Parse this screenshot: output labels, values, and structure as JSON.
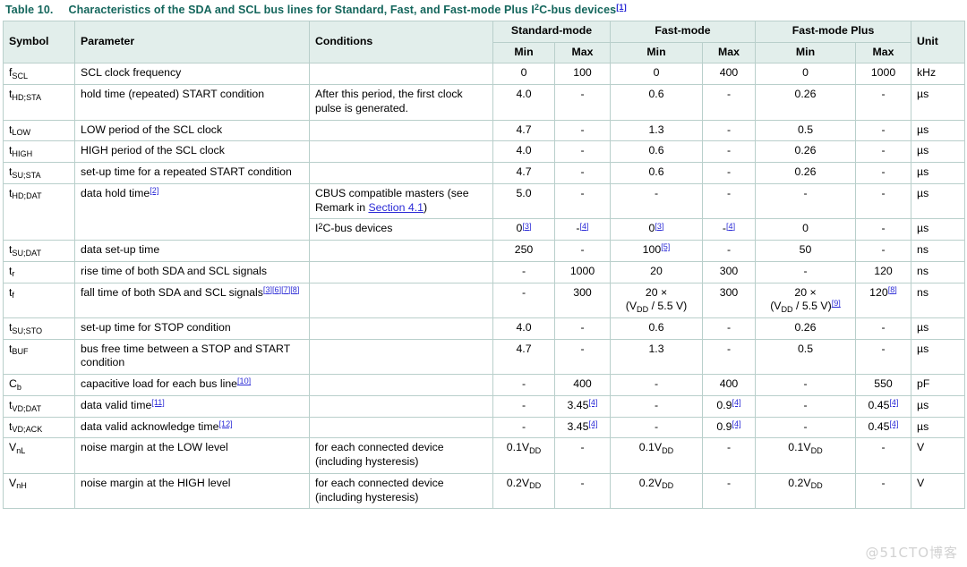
{
  "caption": {
    "number": "Table 10.",
    "text_before": "Characteristics of the SDA and SCL bus lines for Standard, Fast, and Fast-mode Plus I",
    "sup": "2",
    "text_after": "C-bus devices",
    "footnote": "[1]"
  },
  "header": {
    "symbol": "Symbol",
    "parameter": "Parameter",
    "conditions": "Conditions",
    "standard_mode": "Standard-mode",
    "fast_mode": "Fast-mode",
    "fast_mode_plus": "Fast-mode Plus",
    "unit": "Unit",
    "min": "Min",
    "max": "Max"
  },
  "watermark": "@51CTO博客",
  "colors": {
    "caption_text": "#14665c",
    "header_bg": "#e2eeeb",
    "border": "#b9cfcb",
    "link": "#2b2bd6",
    "watermark": "#d2d2d2"
  },
  "rows": [
    {
      "symbol_base": "f",
      "symbol_sub": "SCL",
      "parameter": "SCL clock frequency",
      "conditions": "",
      "sm_min": "0",
      "sm_max": "100",
      "fm_min": "0",
      "fm_max": "400",
      "fmp_min": "0",
      "fmp_max": "1000",
      "unit": "kHz"
    },
    {
      "symbol_base": "t",
      "symbol_sub": "HD;STA",
      "parameter": "hold time (repeated) START condition",
      "conditions": "After this period, the first clock pulse is generated.",
      "sm_min": "4.0",
      "sm_max": "-",
      "fm_min": "0.6",
      "fm_max": "-",
      "fmp_min": "0.26",
      "fmp_max": "-",
      "unit": "µs"
    },
    {
      "symbol_base": "t",
      "symbol_sub": "LOW",
      "parameter": "LOW period of the SCL clock",
      "conditions": "",
      "sm_min": "4.7",
      "sm_max": "-",
      "fm_min": "1.3",
      "fm_max": "-",
      "fmp_min": "0.5",
      "fmp_max": "-",
      "unit": "µs"
    },
    {
      "symbol_base": "t",
      "symbol_sub": "HIGH",
      "parameter": "HIGH period of the SCL clock",
      "conditions": "",
      "sm_min": "4.0",
      "sm_max": "-",
      "fm_min": "0.6",
      "fm_max": "-",
      "fmp_min": "0.26",
      "fmp_max": "-",
      "unit": "µs"
    },
    {
      "symbol_base": "t",
      "symbol_sub": "SU;STA",
      "parameter": "set-up time for a repeated START condition",
      "conditions": "",
      "sm_min": "4.7",
      "sm_max": "-",
      "fm_min": "0.6",
      "fm_max": "-",
      "fmp_min": "0.26",
      "fmp_max": "-",
      "unit": "µs"
    },
    {
      "symbol_base": "t",
      "symbol_sub": "HD;DAT",
      "parameter": "data hold time",
      "parameter_fn": "[2]",
      "conditions_a": "CBUS compatible masters (see Remark in ",
      "conditions_link": "Section 4.1",
      "conditions_b": ")",
      "sm_min": "5.0",
      "sm_max": "-",
      "fm_min": "-",
      "fm_max": "-",
      "fmp_min": "-",
      "fmp_max": "-",
      "unit": "µs"
    },
    {
      "symbol_base": "",
      "symbol_sub": "",
      "parameter": "",
      "conditions_i2c_pre": "I",
      "conditions_i2c_sup": "2",
      "conditions_i2c_post": "C-bus devices",
      "sm_min": "0",
      "sm_min_fn": "[3]",
      "sm_max": "-",
      "sm_max_fn": "[4]",
      "fm_min": "0",
      "fm_min_fn": "[3]",
      "fm_max": "-",
      "fm_max_fn": "[4]",
      "fmp_min": "0",
      "fmp_max": "-",
      "unit": "µs"
    },
    {
      "symbol_base": "t",
      "symbol_sub": "SU;DAT",
      "parameter": "data set-up time",
      "conditions": "",
      "sm_min": "250",
      "sm_max": "-",
      "fm_min": "100",
      "fm_min_fn": "[5]",
      "fm_max": "-",
      "fmp_min": "50",
      "fmp_max": "-",
      "unit": "ns"
    },
    {
      "symbol_base": "t",
      "symbol_sub": "r",
      "parameter": "rise time of both SDA and SCL signals",
      "conditions": "",
      "sm_min": "-",
      "sm_max": "1000",
      "fm_min": "20",
      "fm_max": "300",
      "fmp_min": "-",
      "fmp_max": "120",
      "unit": "ns"
    },
    {
      "symbol_base": "t",
      "symbol_sub": "f",
      "parameter": "fall time of both SDA and SCL signals",
      "parameter_fn": "[3][6][7][8]",
      "conditions": "",
      "sm_min": "-",
      "sm_max": "300",
      "fm_min": "20 ×",
      "fm_min_line2": "(VDD / 5.5 V)",
      "fm_max": "300",
      "fmp_min": "20 ×",
      "fmp_min_line2": "(VDD / 5.5 V)",
      "fmp_min_fn": "[9]",
      "fmp_max": "120",
      "fmp_max_fn": "[8]",
      "unit": "ns"
    },
    {
      "symbol_base": "t",
      "symbol_sub": "SU;STO",
      "parameter": "set-up time for STOP condition",
      "conditions": "",
      "sm_min": "4.0",
      "sm_max": "-",
      "fm_min": "0.6",
      "fm_max": "-",
      "fmp_min": "0.26",
      "fmp_max": "-",
      "unit": "µs"
    },
    {
      "symbol_base": "t",
      "symbol_sub": "BUF",
      "parameter": "bus free time between a STOP and START condition",
      "conditions": "",
      "sm_min": "4.7",
      "sm_max": "-",
      "fm_min": "1.3",
      "fm_max": "-",
      "fmp_min": "0.5",
      "fmp_max": "-",
      "unit": "µs"
    },
    {
      "symbol_base": "C",
      "symbol_sub": "b",
      "parameter": "capacitive load for each bus line",
      "parameter_fn": "[10]",
      "conditions": "",
      "sm_min": "-",
      "sm_max": "400",
      "fm_min": "-",
      "fm_max": "400",
      "fmp_min": "-",
      "fmp_max": "550",
      "unit": "pF"
    },
    {
      "symbol_base": "t",
      "symbol_sub": "VD;DAT",
      "parameter": "data valid time",
      "parameter_fn": "[11]",
      "conditions": "",
      "sm_min": "-",
      "sm_max": "3.45",
      "sm_max_fn": "[4]",
      "fm_min": "-",
      "fm_max": "0.9",
      "fm_max_fn": "[4]",
      "fmp_min": "-",
      "fmp_max": "0.45",
      "fmp_max_fn": "[4]",
      "unit": "µs"
    },
    {
      "symbol_base": "t",
      "symbol_sub": "VD;ACK",
      "parameter": "data valid acknowledge time",
      "parameter_fn": "[12]",
      "conditions": "",
      "sm_min": "-",
      "sm_max": "3.45",
      "sm_max_fn": "[4]",
      "fm_min": "-",
      "fm_max": "0.9",
      "fm_max_fn": "[4]",
      "fmp_min": "-",
      "fmp_max": "0.45",
      "fmp_max_fn": "[4]",
      "unit": "µs"
    },
    {
      "symbol_base": "V",
      "symbol_sub": "nL",
      "parameter": "noise margin at the LOW level",
      "conditions": "for each connected device (including hysteresis)",
      "sm_min": "0.1VDD",
      "sm_max": "-",
      "fm_min": "0.1VDD",
      "fm_max": "-",
      "fmp_min": "0.1VDD",
      "fmp_max": "-",
      "unit": "V"
    },
    {
      "symbol_base": "V",
      "symbol_sub": "nH",
      "parameter": "noise margin at the HIGH level",
      "conditions": "for each connected device (including hysteresis)",
      "sm_min": "0.2VDD",
      "sm_max": "-",
      "fm_min": "0.2VDD",
      "fm_max": "-",
      "fmp_min": "0.2VDD",
      "fmp_max": "-",
      "unit": "V"
    }
  ]
}
